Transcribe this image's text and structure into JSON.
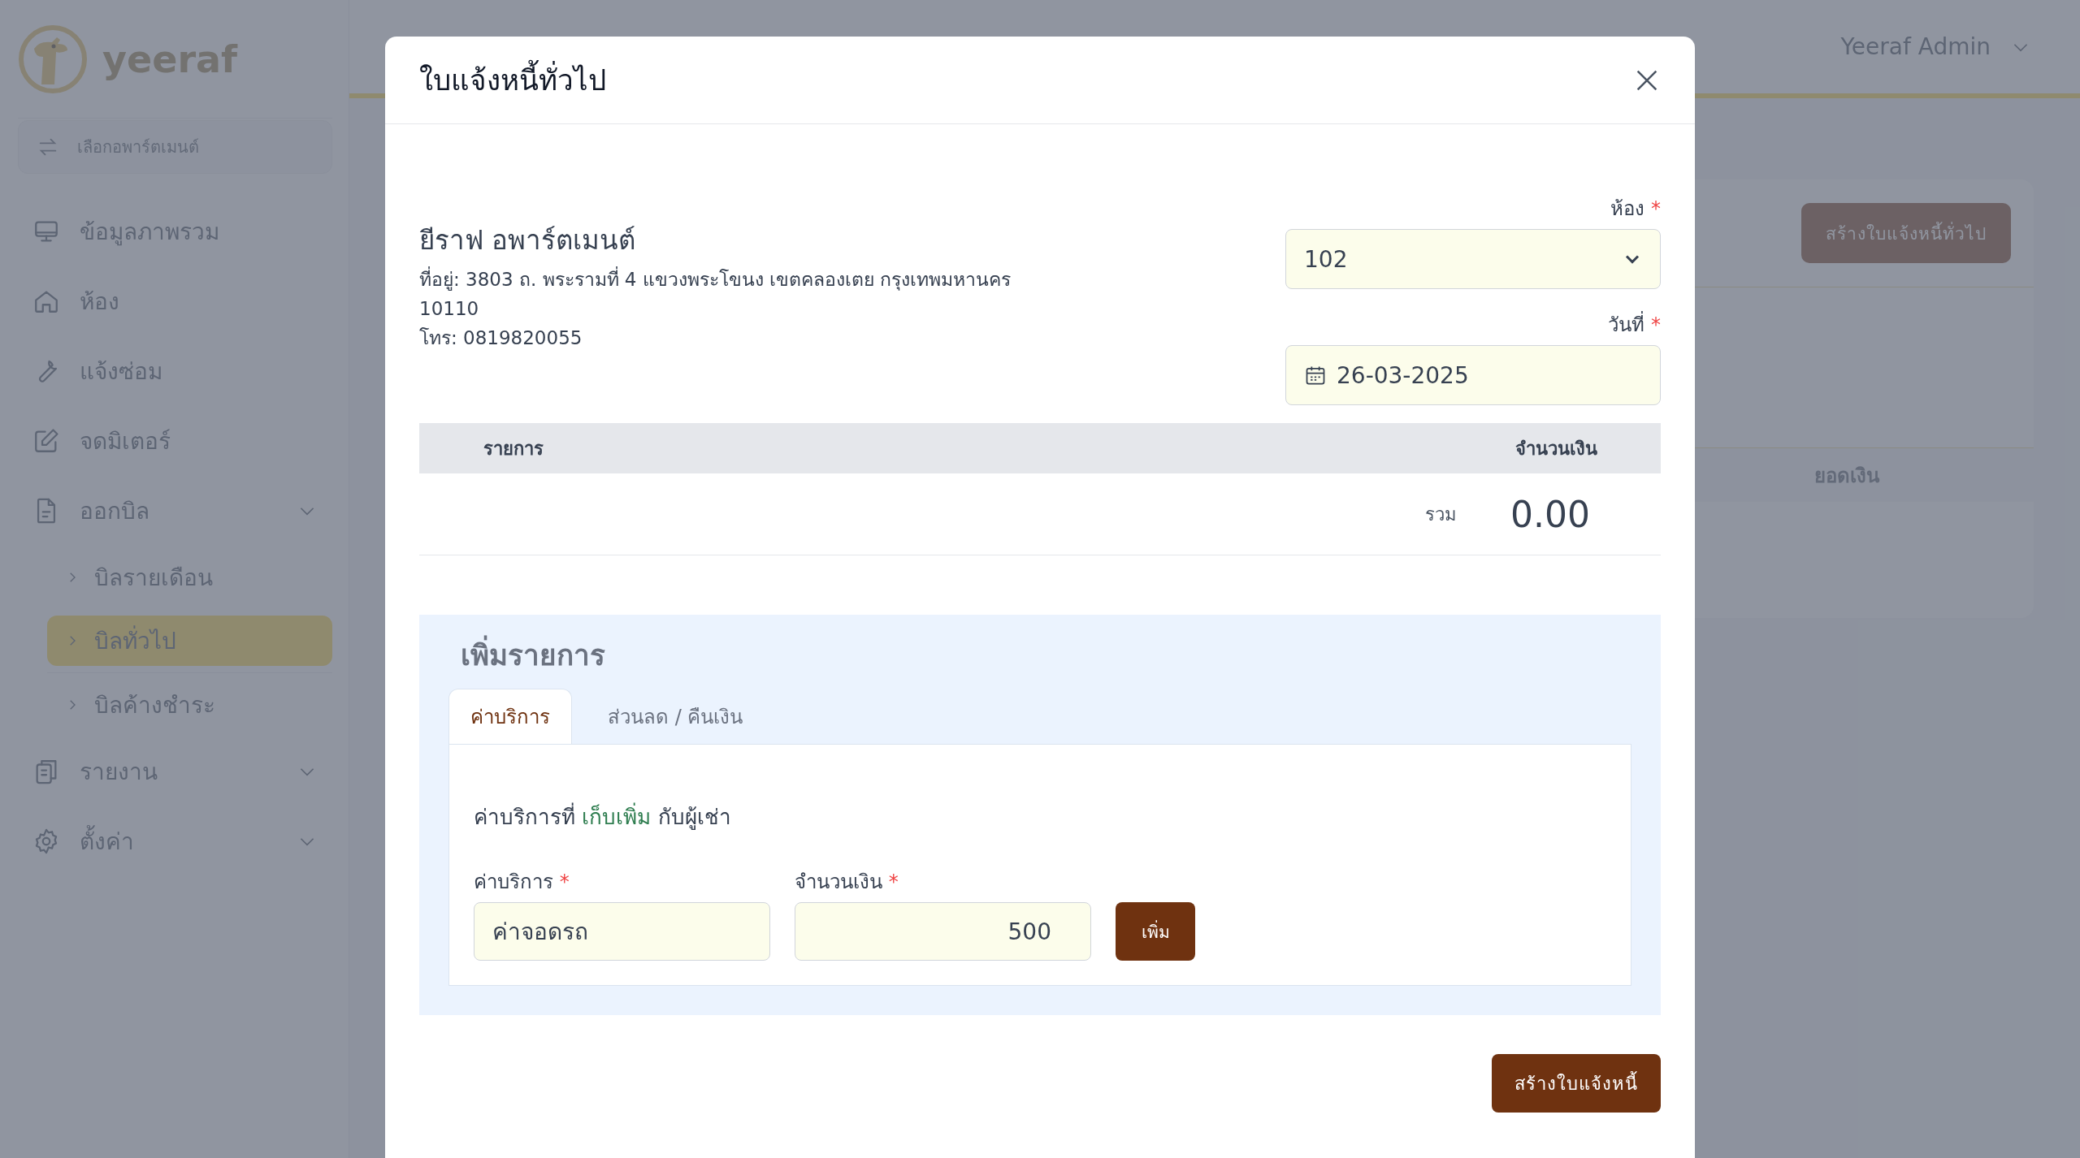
{
  "sidebar": {
    "logo_text": "yeeraf",
    "apartment_picker": {
      "placeholder": "เลือกอพาร์ตเมนต์"
    },
    "items": [
      {
        "label": "ข้อมูลภาพรวม"
      },
      {
        "label": "ห้อง"
      },
      {
        "label": "แจ้งซ่อม"
      },
      {
        "label": "จดมิเตอร์"
      },
      {
        "label": "ออกบิล",
        "children": [
          {
            "label": "บิลรายเดือน",
            "selected": false
          },
          {
            "label": "บิลทั่วไป",
            "selected": true
          },
          {
            "label": "บิลค้างชำระ",
            "selected": false
          }
        ]
      },
      {
        "label": "รายงาน"
      },
      {
        "label": "ตั้งค่า"
      }
    ]
  },
  "header": {
    "user": "Yeeraf Admin"
  },
  "card": {
    "button": "สร้างใบแจ้งหนี้ทั่วไป",
    "columns": [
      "ยอดเงิน"
    ]
  },
  "modal": {
    "title": "ใบแจ้งหนี้ทั่วไป",
    "company": {
      "name": "ยีราฟ อพาร์ตเมนต์",
      "address": "ที่อยู่: 3803 ถ. พระรามที่ 4 แขวงพระโขนง เขตคลองเตย กรุงเทพมหานคร 10110",
      "phone": "โทร: 0819820055"
    },
    "room": {
      "label": "ห้อง",
      "mark": "*",
      "value": "102"
    },
    "date": {
      "label": "วันที่",
      "mark": "*",
      "value": "26-03-2025"
    },
    "table": {
      "columns": [
        "รายการ",
        "จำนวนเงิน"
      ],
      "total_label": "รวม",
      "total": "0.00"
    },
    "add_section": {
      "title": "เพิ่มรายการ",
      "tabs": [
        {
          "label": "ค่าบริการ",
          "selected": true
        },
        {
          "label": "ส่วนลด / คืนเงิน",
          "selected": false
        }
      ],
      "description": {
        "before": "ค่าบริการที่",
        "highlight": "เก็บเพิ่ม",
        "after": "กับผู้เช่า"
      },
      "service": {
        "label": "ค่าบริการ",
        "mark": "*",
        "value": "ค่าจอดรถ"
      },
      "amount": {
        "label": "จำนวนเงิน",
        "mark": "*",
        "value": "500"
      },
      "add_button": "เพิ่ม"
    },
    "submit": "สร้างใบแจ้งหนี้"
  }
}
